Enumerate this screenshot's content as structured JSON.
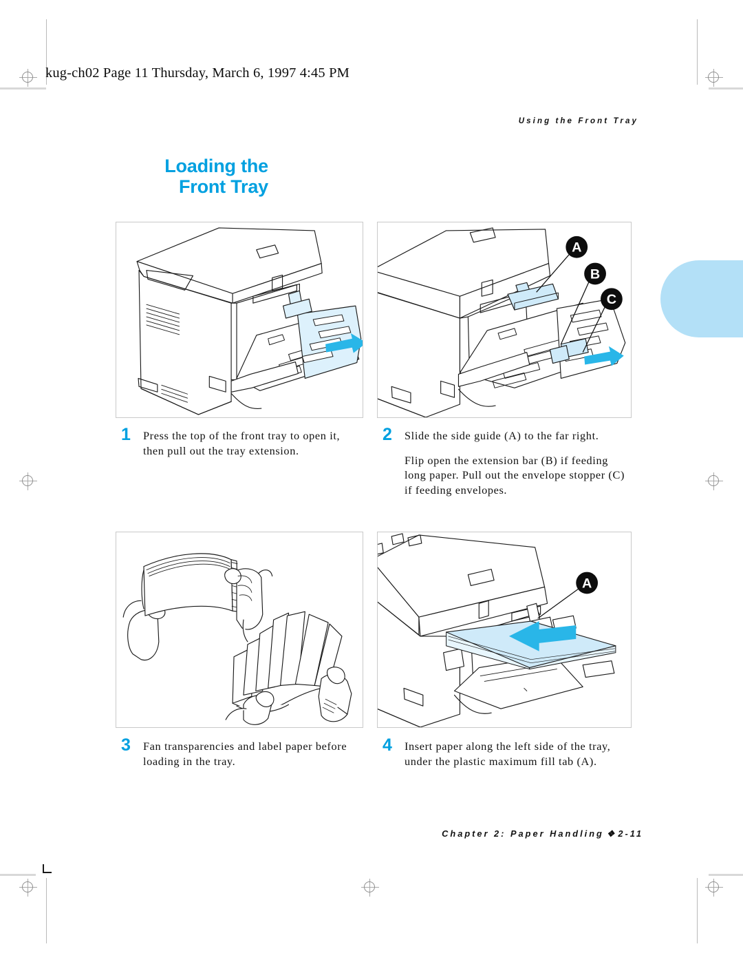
{
  "print_header": {
    "text": "kug-ch02  Page 11  Thursday, March 6, 1997  4:45 PM"
  },
  "running_head": {
    "text": "Using the Front Tray"
  },
  "title": {
    "line1": "Loading the",
    "line2": "Front Tray",
    "color": "#00a0e0"
  },
  "steps": [
    {
      "number": "1",
      "paragraphs": [
        "Press the top of the front tray to open it, then pull out the tray extension."
      ]
    },
    {
      "number": "2",
      "paragraphs": [
        "Slide the side guide (A) to the far right.",
        "Flip open the extension bar (B) if feeding long paper. Pull out the envelope stopper (C) if feeding envelopes."
      ]
    },
    {
      "number": "3",
      "paragraphs": [
        "Fan transparencies and label paper before loading in the tray."
      ]
    },
    {
      "number": "4",
      "paragraphs": [
        "Insert paper along the left side of the tray, under the plastic maximum fill tab (A)."
      ]
    }
  ],
  "figures": {
    "figure1": {
      "alt": "Printer with front tray opened and tray extension being pulled out",
      "callouts": []
    },
    "figure2": {
      "alt": "Close-up of front tray showing side guide, extension bar and envelope stopper",
      "callouts": [
        "A",
        "B",
        "C"
      ]
    },
    "figure3": {
      "alt": "Two hands fanning a stack of paper",
      "callouts": []
    },
    "figure4": {
      "alt": "Paper stack being inserted into the front tray under the maximum fill tab",
      "callouts": [
        "A"
      ]
    }
  },
  "footer": {
    "chapter": "Chapter 2: Paper Handling",
    "separator": "❖",
    "page": "2-11"
  },
  "colors": {
    "accent_cyan": "#00a0e0",
    "tint_cyan": "#b3e0f7",
    "arrow_cyan": "#29b6e8"
  }
}
